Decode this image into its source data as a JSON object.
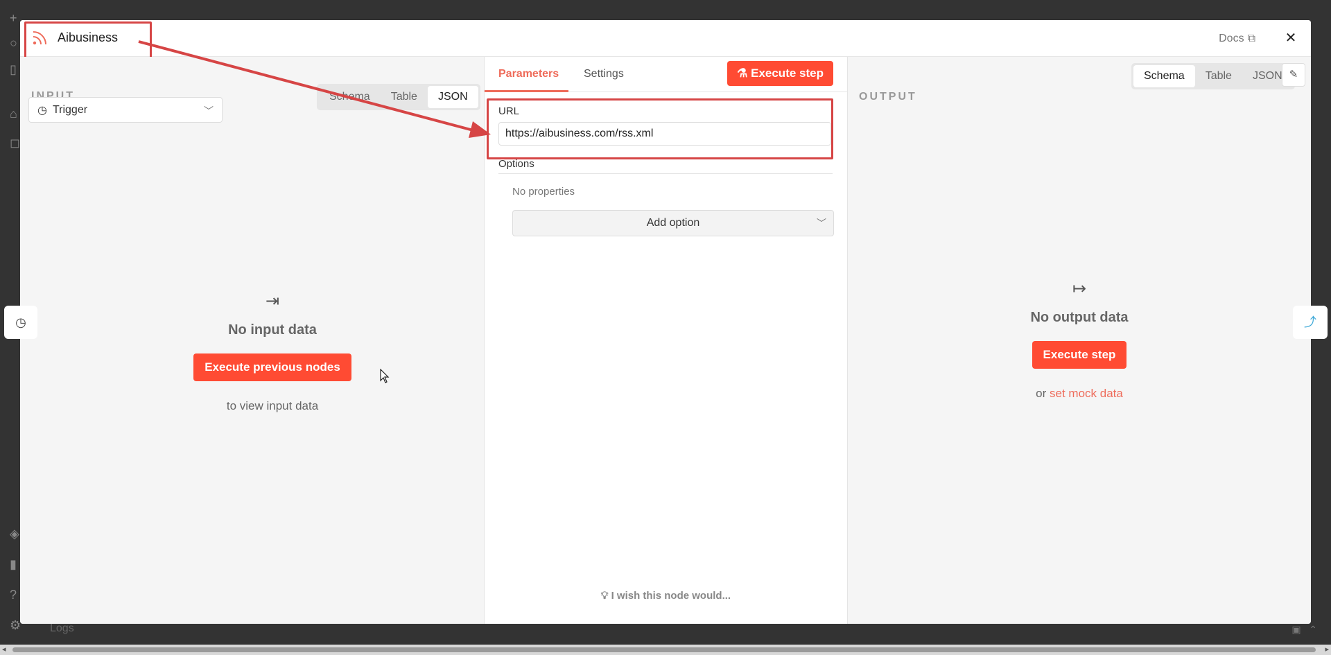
{
  "node": {
    "title": "Aibusiness",
    "icon": "rss-icon"
  },
  "header": {
    "docs_label": "Docs",
    "close_label": "✕",
    "drag_handle": "|||"
  },
  "input": {
    "label": "INPUT",
    "tabs": [
      "Schema",
      "Table",
      "JSON"
    ],
    "active_tab": "JSON",
    "trigger_select": "Trigger",
    "empty_title": "No input data",
    "execute_previous": "Execute previous nodes",
    "view_hint": "to view input data"
  },
  "parameters": {
    "tabs": [
      "Parameters",
      "Settings"
    ],
    "active_tab": "Parameters",
    "execute_step": "Execute step",
    "url_label": "URL",
    "url_value": "https://aibusiness.com/rss.xml",
    "options_label": "Options",
    "no_properties": "No properties",
    "add_option": "Add option",
    "wish": "I wish this node would..."
  },
  "output": {
    "label": "OUTPUT",
    "tabs": [
      "Schema",
      "Table",
      "JSON"
    ],
    "active_tab": "Schema",
    "empty_title": "No output data",
    "execute_step": "Execute step",
    "or_text": "or",
    "mock_link": "set mock data"
  },
  "background": {
    "logs_label": "Logs"
  },
  "colors": {
    "accent": "#ff4b33",
    "annotation": "#d64545",
    "link": "#ee6b5a"
  }
}
